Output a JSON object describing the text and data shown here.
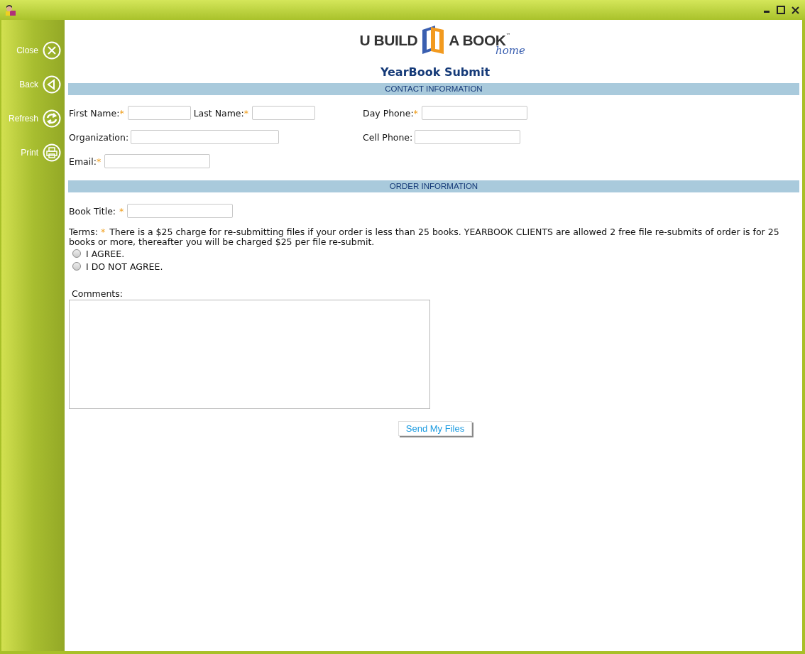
{
  "sidebar": {
    "items": [
      {
        "label": "Close"
      },
      {
        "label": "Back"
      },
      {
        "label": "Refresh"
      },
      {
        "label": "Print"
      }
    ]
  },
  "logo": {
    "left": "U BUILD",
    "right": "A BOOK",
    "tm": "™",
    "sub": "home"
  },
  "title": "YearBook Submit",
  "required_mark": "*",
  "contact": {
    "heading": "CONTACT INFORMATION",
    "left_rows": [
      [
        {
          "label": "First Name:",
          "required": true
        },
        {
          "label": "Last Name:",
          "required": true
        }
      ],
      [
        {
          "label": "Organization:",
          "required": false
        }
      ],
      [
        {
          "label": "Email:",
          "required": true
        }
      ]
    ],
    "right_rows": [
      [
        {
          "label": "Day Phone:",
          "required": true
        }
      ],
      [
        {
          "label": "Cell Phone:",
          "required": false
        }
      ]
    ]
  },
  "order": {
    "heading": "ORDER INFORMATION",
    "book_title": {
      "label": "Book Title:",
      "required": true
    },
    "terms": {
      "label": "Terms:",
      "required": true,
      "text": "There is a $25 charge for re-submitting files if your order is less than 25 books. YEARBOOK CLIENTS are allowed 2 free file re-submits of order is for 25 books or more, thereafter you will be charged $25 per file re-submit."
    },
    "options": [
      {
        "label": "I AGREE.",
        "selected": false
      },
      {
        "label": "I DO NOT AGREE.",
        "selected": false
      }
    ],
    "comments_label": "Comments:"
  },
  "submit": "Send My Files"
}
